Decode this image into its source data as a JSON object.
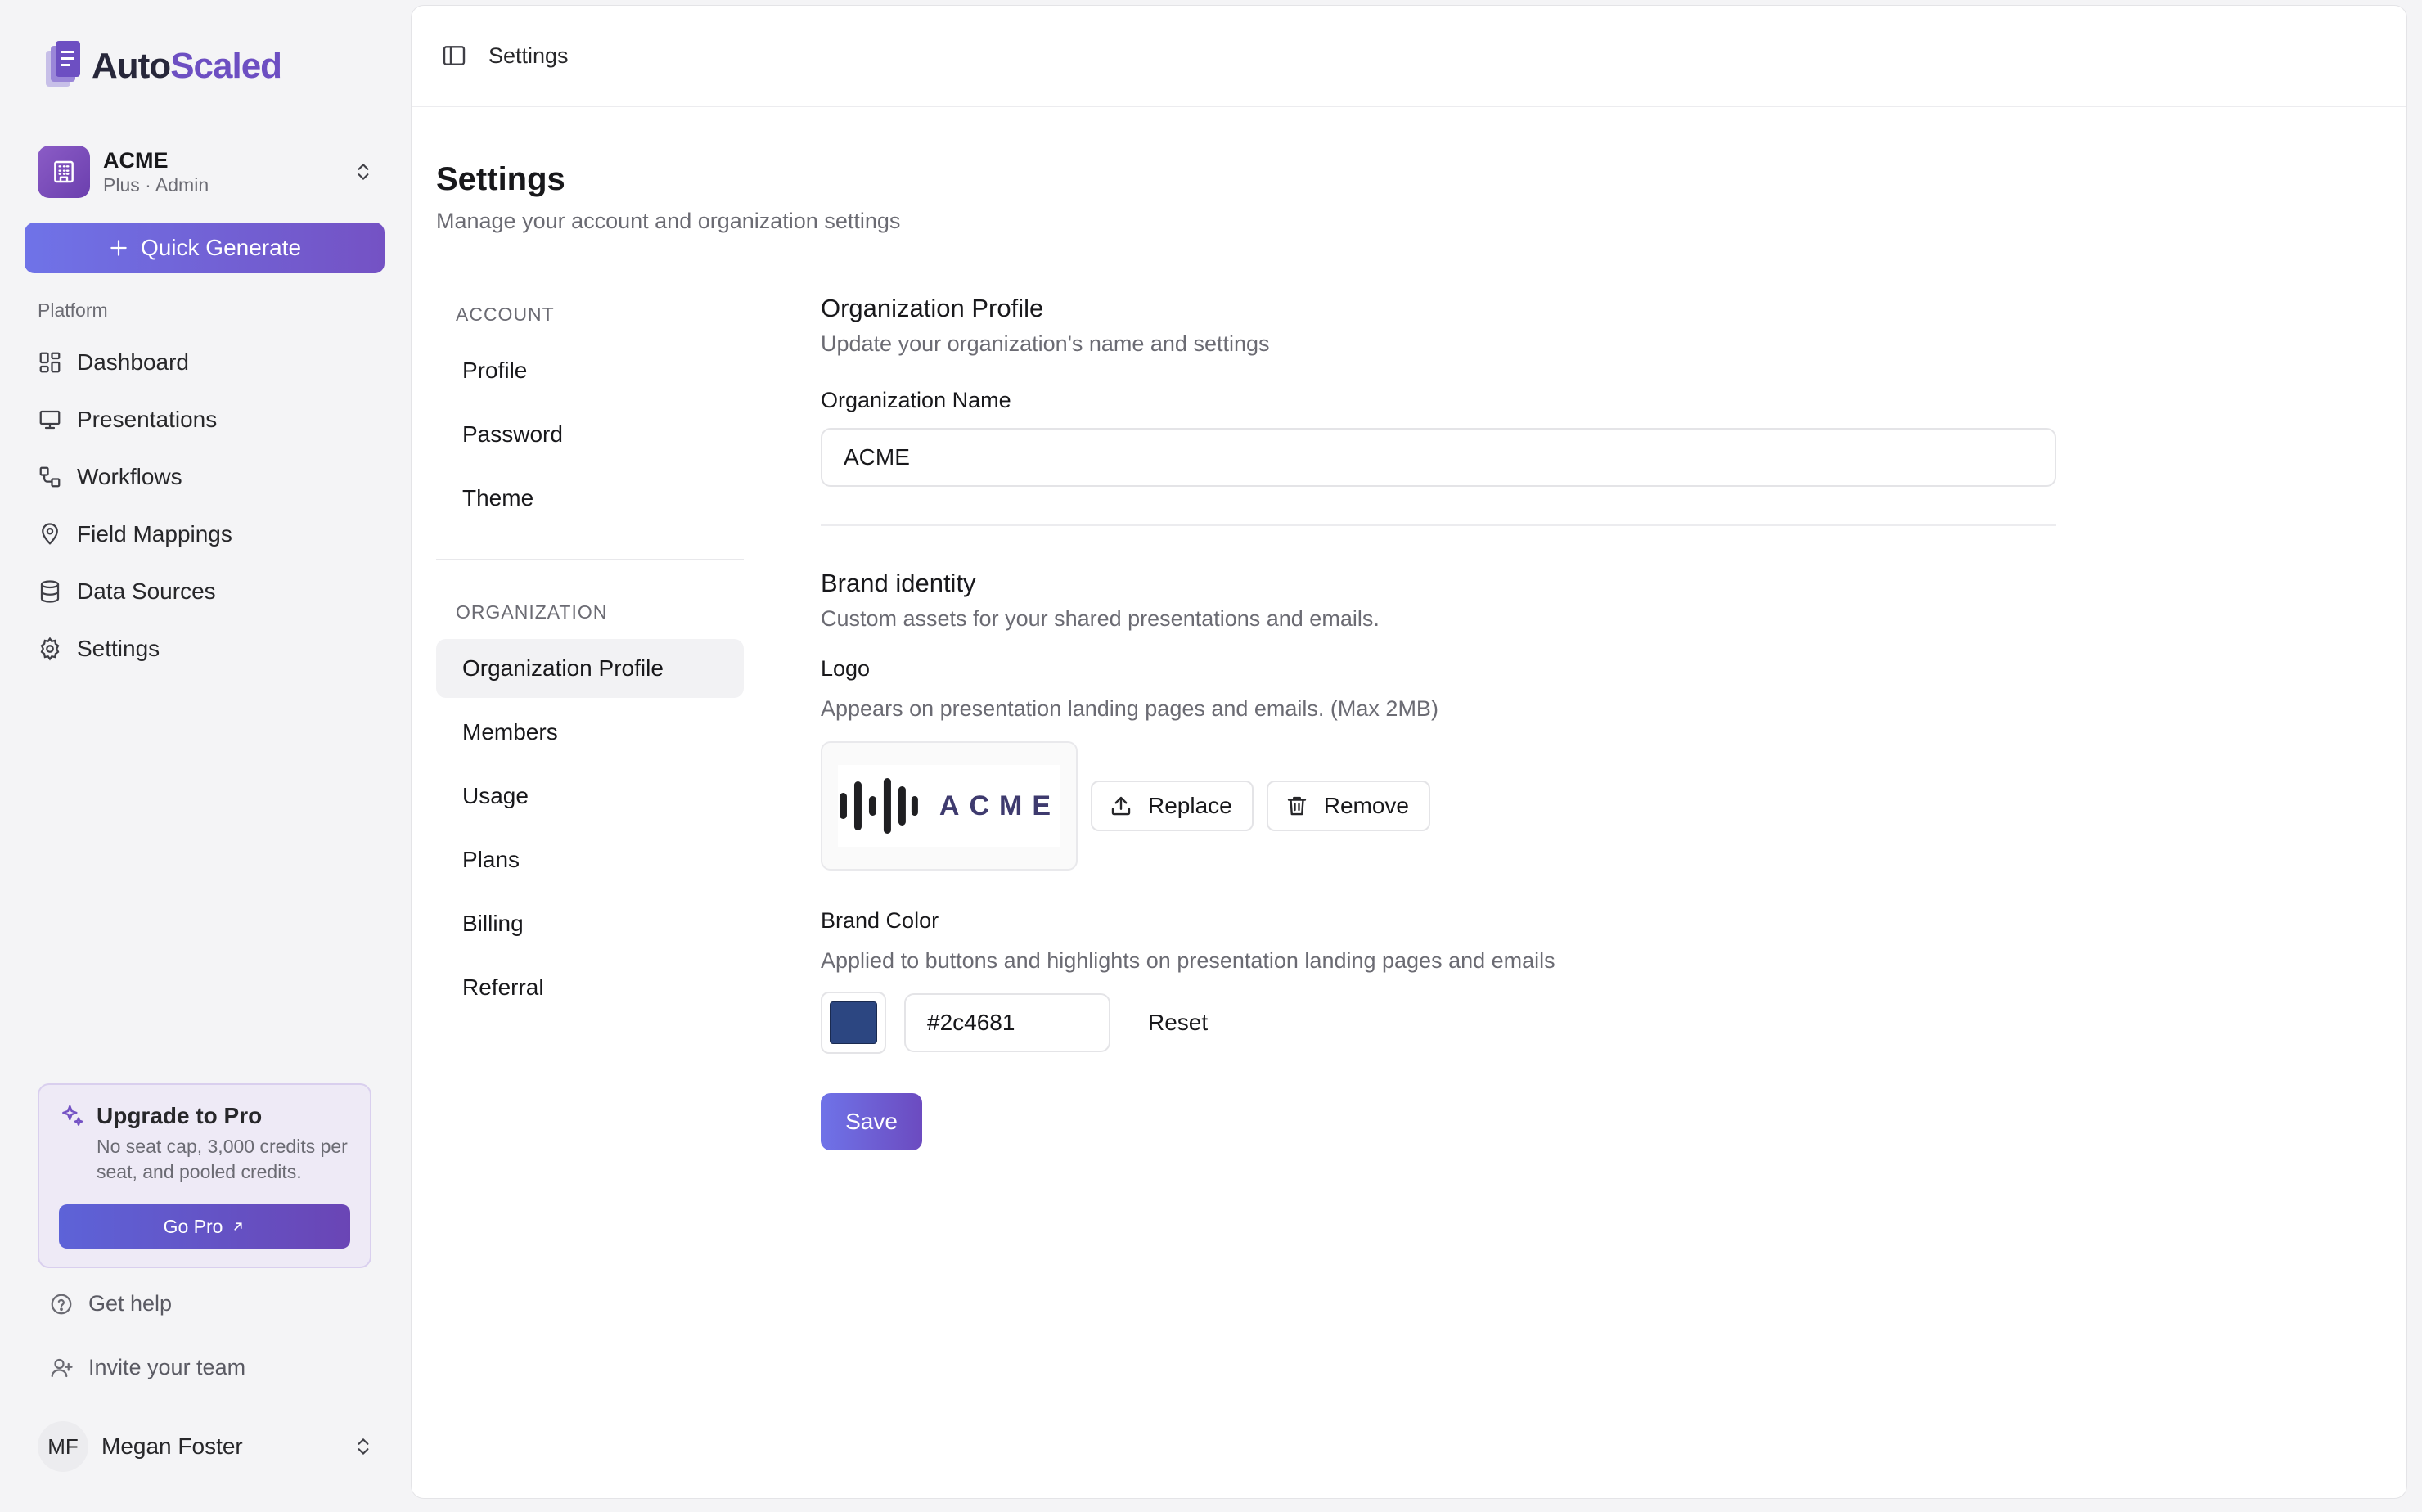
{
  "brand": {
    "name_part1": "Auto",
    "name_part2": "Scaled"
  },
  "org": {
    "name": "ACME",
    "subtitle": "Plus · Admin"
  },
  "quick_generate": {
    "label": "Quick Generate"
  },
  "nav": {
    "title": "Platform",
    "items": [
      {
        "label": "Dashboard",
        "icon": "dashboard-icon"
      },
      {
        "label": "Presentations",
        "icon": "presentation-icon"
      },
      {
        "label": "Workflows",
        "icon": "workflow-icon"
      },
      {
        "label": "Field Mappings",
        "icon": "map-pin-icon"
      },
      {
        "label": "Data Sources",
        "icon": "database-icon"
      },
      {
        "label": "Settings",
        "icon": "gear-icon"
      }
    ]
  },
  "upgrade": {
    "title": "Upgrade to Pro",
    "body": "No seat cap, 3,000 credits per seat, and pooled credits.",
    "button": "Go Pro"
  },
  "footer_links": {
    "help": "Get help",
    "invite": "Invite your team"
  },
  "user": {
    "initials": "MF",
    "name": "Megan Foster"
  },
  "topbar": {
    "title": "Settings"
  },
  "page": {
    "title": "Settings",
    "subtitle": "Manage your account and organization settings"
  },
  "subnav": {
    "account_title": "ACCOUNT",
    "account_items": [
      "Profile",
      "Password",
      "Theme"
    ],
    "org_title": "ORGANIZATION",
    "org_items": [
      "Organization Profile",
      "Members",
      "Usage",
      "Plans",
      "Billing",
      "Referral"
    ],
    "active": "Organization Profile"
  },
  "org_profile": {
    "title": "Organization Profile",
    "description": "Update your organization's name and settings",
    "name_label": "Organization Name",
    "name_value": "ACME"
  },
  "brand_identity": {
    "title": "Brand identity",
    "description": "Custom assets for your shared presentations and emails.",
    "logo_label": "Logo",
    "logo_description": "Appears on presentation landing pages and emails. (Max 2MB)",
    "logo_word": "ACME",
    "replace_label": "Replace",
    "remove_label": "Remove",
    "color_label": "Brand Color",
    "color_description": "Applied to buttons and highlights on presentation landing pages and emails",
    "color_value": "#2c4681",
    "reset_label": "Reset",
    "save_label": "Save"
  },
  "colors": {
    "accent": "#6f73e8",
    "accent_purple": "#7452c4",
    "brand_color": "#2c4681"
  }
}
